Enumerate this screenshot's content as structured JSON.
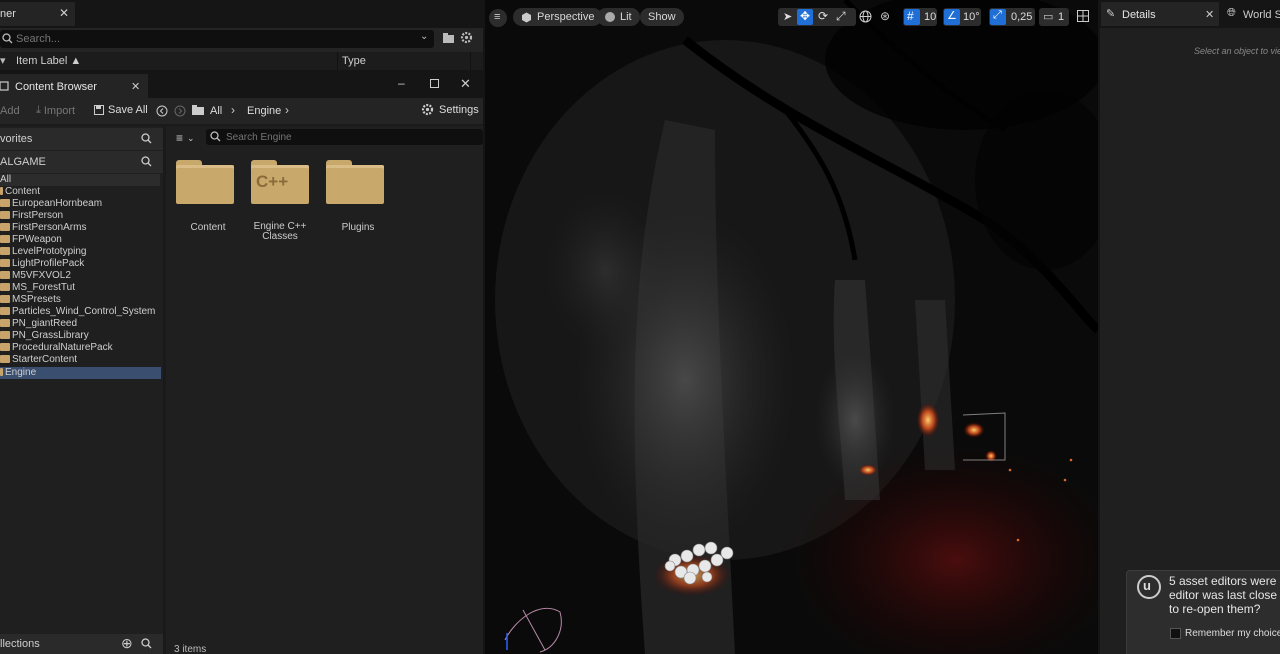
{
  "outliner": {
    "tab_label": "ner",
    "search_placeholder": "Search...",
    "col_item_label": "Item Label ▲",
    "col_type": "Type"
  },
  "content_browser": {
    "tab_label": "Content Browser",
    "toolbar": {
      "add": "Add",
      "import": "Import",
      "save_all": "Save All",
      "crumb_all": "All",
      "crumb_engine": "Engine",
      "settings": "Settings"
    },
    "favorites_label": "vorites",
    "project_label": "ALGAME",
    "tree": [
      "All",
      "Content",
      "EuropeanHornbeam",
      "FirstPerson",
      "FirstPersonArms",
      "FPWeapon",
      "LevelPrototyping",
      "LightProfilePack",
      "M5VFXVOL2",
      "MS_ForestTut",
      "MSPresets",
      "Particles_Wind_Control_System",
      "PN_giantReed",
      "PN_GrassLibrary",
      "ProceduralNaturePack",
      "StarterContent",
      "Engine"
    ],
    "collections_label": "llections",
    "search_placeholder": "Search Engine",
    "folders": [
      {
        "label": "Content"
      },
      {
        "label": "Engine C++ Classes",
        "badge": "C++"
      },
      {
        "label": "Plugins"
      }
    ],
    "item_count": "3 items"
  },
  "viewport": {
    "perspective": "Perspective",
    "lit": "Lit",
    "show": "Show",
    "grid_size": "10",
    "rotation_snap": "10°",
    "scale_snap": "0,25",
    "camera_speed": "1"
  },
  "details": {
    "tab_label": "Details",
    "world_tab_label": "World Se",
    "empty_text": "Select an object to vie"
  },
  "notification": {
    "line1": "5 asset editors were",
    "line2": "editor was last close",
    "line3": "to re-open them?",
    "remember": "Remember my choice"
  },
  "colors": {
    "accent_blue": "#1f6fd6",
    "folder": "#c9a86c",
    "selection": "#3a4f70"
  }
}
